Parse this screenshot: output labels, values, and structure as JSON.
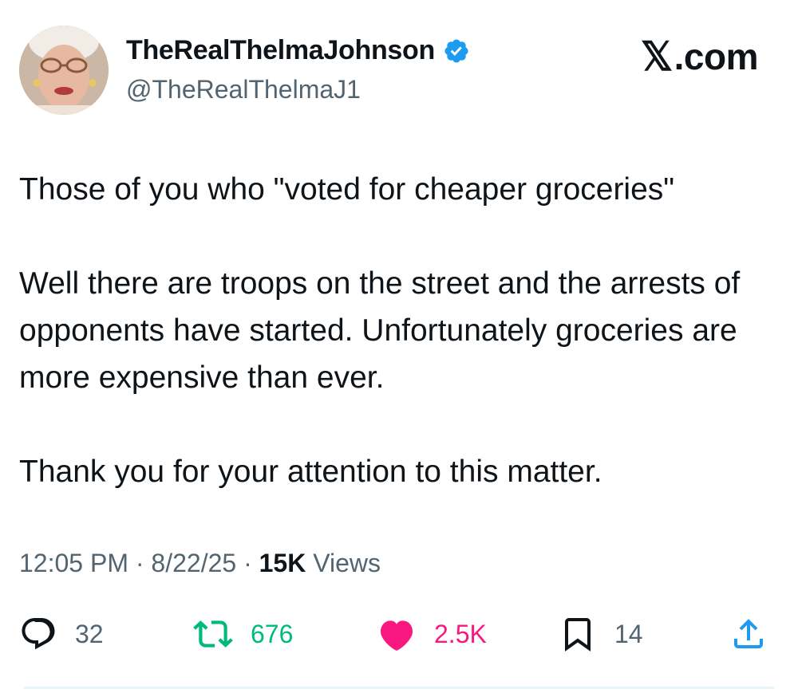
{
  "author": {
    "display_name": "TheRealThelmaJohnson",
    "handle": "@TheRealThelmaJ1",
    "verified": true,
    "avatar_icon": "elderly-woman-portrait"
  },
  "brand": {
    "label": ".com",
    "mark": "𝕏"
  },
  "tweet": {
    "paragraphs": [
      "Those of you who \"voted for cheaper groceries\"",
      "Well there are troops on the street and the arrests of opponents have started.  Unfortunately groceries are more expensive than ever.",
      "Thank you for your attention to this matter."
    ]
  },
  "meta": {
    "time": "12:05 PM",
    "date": "8/22/25",
    "views_count": "15K",
    "views_label": "Views",
    "separator": "·"
  },
  "actions": {
    "replies": "32",
    "reposts": "676",
    "likes": "2.5K",
    "bookmarks": "14"
  },
  "colors": {
    "text": "#0f1419",
    "secondary": "#536471",
    "verified": "#1d9bf0",
    "repost": "#00ba7c",
    "like": "#f91880"
  }
}
